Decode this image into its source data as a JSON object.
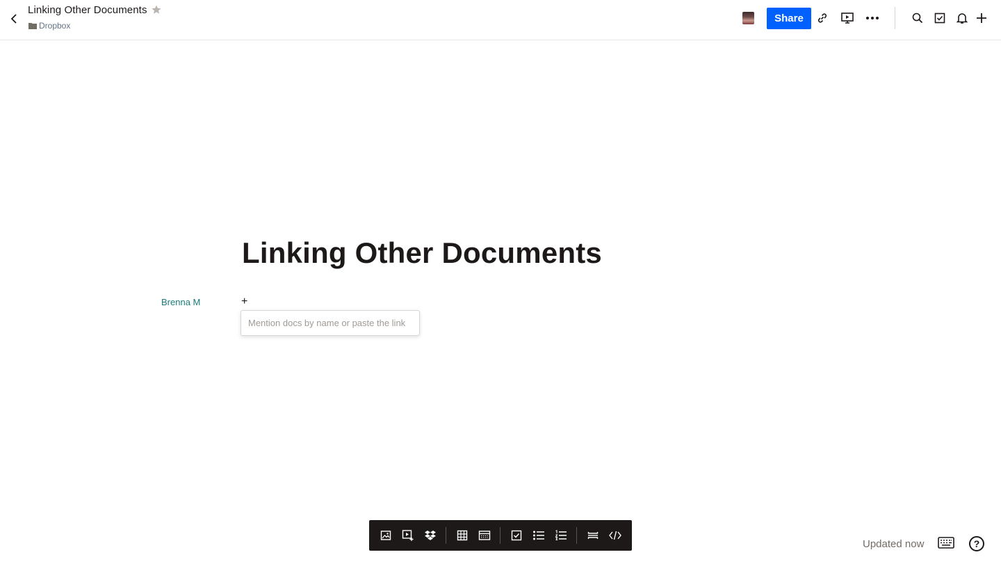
{
  "header": {
    "title": "Linking Other Documents",
    "folder": "Dropbox",
    "share_label": "Share"
  },
  "document": {
    "heading": "Linking Other Documents",
    "author": "Brenna M",
    "plus": "+",
    "mention_placeholder": "Mention docs by name or paste the link",
    "mention_value": ""
  },
  "footer": {
    "status": "Updated now",
    "help_label": "?"
  },
  "colors": {
    "accent": "#0061fe",
    "author": "#1a7c78",
    "toolbar_bg": "#1e1919"
  }
}
